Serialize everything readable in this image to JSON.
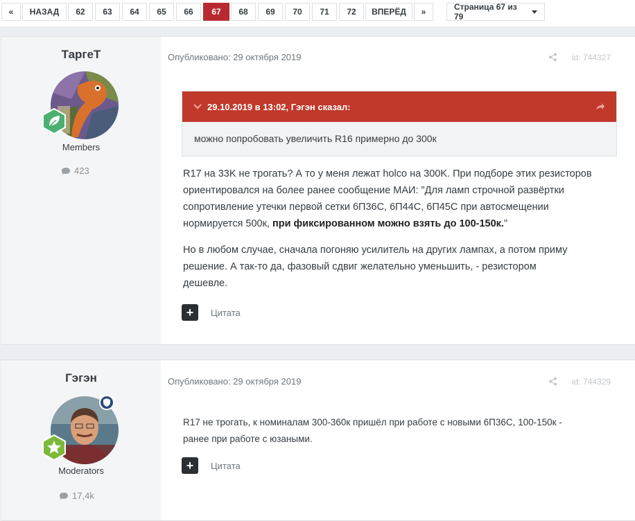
{
  "pagination": {
    "first_icon": "«",
    "prev_label": "НАЗАД",
    "pages": [
      "62",
      "63",
      "64",
      "65",
      "66",
      "67",
      "68",
      "69",
      "70",
      "71",
      "72"
    ],
    "current": "67",
    "next_label": "ВПЕРЁД",
    "last_icon": "»",
    "page_select_label": "Страница 67 из 79"
  },
  "posts": [
    {
      "author": "ТаргеТ",
      "group": "Members",
      "post_count": "423",
      "posted": "Опубликовано: 29 октября 2019",
      "post_id": "id: 744327",
      "quote": {
        "header": "29.10.2019 в 13:02, Гэгэн сказал:",
        "body": "можно попробовать  увеличить R16  примерно до 300к"
      },
      "paragraphs": [
        {
          "lines": [
            "R17 на 33K не трогать? А то у меня лежат holco на 300K. При подборе этих резисторов",
            "ориентировался на более ранее сообщение МАИ: \"Для ламп строчной развёртки",
            "сопротивление утечки первой сетки 6П36С, 6П44С, 6П45С при автосмещении"
          ],
          "last_line_plain": "нормируется 500к, ",
          "last_line_bold": "при фиксированном можно взять до 100-150к.",
          "last_line_end": "\""
        },
        {
          "lines": [
            "Но в любом случае, сначала погоняю  усилитель на других лампах, а потом приму",
            "решение. А так-то да, фазовый сдвиг желательно уменьшить, - резистором",
            "дешевле."
          ]
        }
      ],
      "quote_button": "Цитата"
    },
    {
      "author": "Гэгэн",
      "group": "Moderators",
      "post_count": "17,4k",
      "posted": "Опубликовано: 29 октября 2019",
      "post_id": "id: 744329",
      "paragraphs": [
        {
          "lines": [
            "R17 не трогать,  к  номиналам 300-360к  пришёл при работе с новыми 6П36С,  100-150к -",
            "ранее при работе с юзаными."
          ]
        }
      ],
      "quote_button": "Цитата"
    }
  ],
  "colors": {
    "accent": "#b72b30",
    "quote_header": "#c0392b",
    "rank_green": "#4caf72",
    "moderator_badge": "#2a4a7a"
  },
  "icons": [
    "double-chevron-left-icon",
    "double-chevron-right-icon",
    "chevron-down-icon",
    "leaf-icon",
    "star-icon",
    "shield-icon",
    "speech-bubble-icon",
    "share-icon",
    "quote-chevron-icon",
    "reply-arrow-icon",
    "plus-icon"
  ]
}
